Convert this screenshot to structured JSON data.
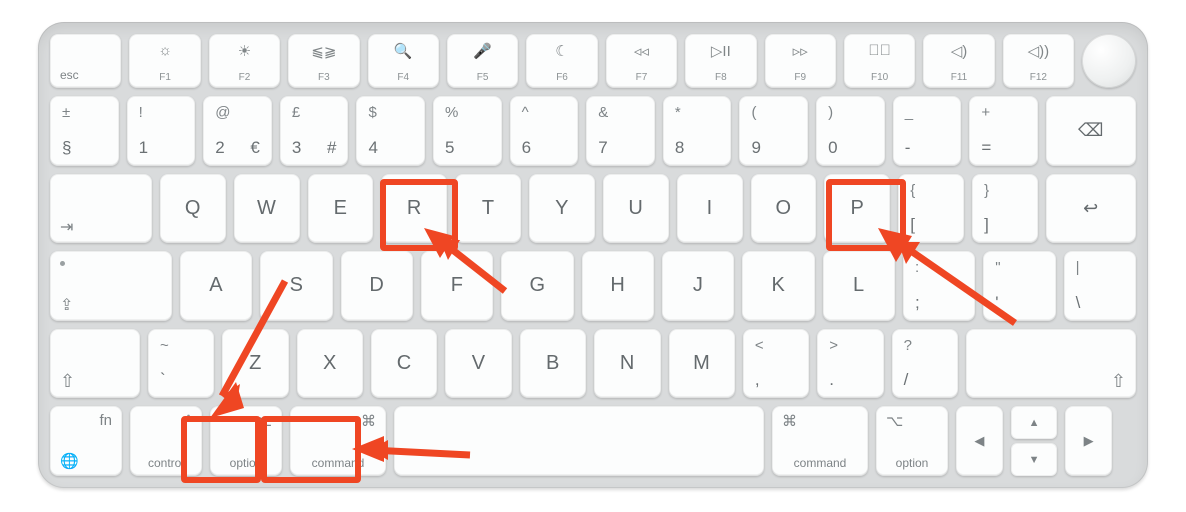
{
  "annotations": {
    "highlight_color": "#ef4623",
    "highlighted_keys": [
      "R",
      "P",
      "option-left",
      "command-left"
    ]
  },
  "fn": {
    "esc": "esc",
    "keys": [
      {
        "icon": "☼",
        "sub": "F1"
      },
      {
        "icon": "☀",
        "sub": "F2"
      },
      {
        "icon": "⫹⫺",
        "sub": "F3"
      },
      {
        "icon": "🔍",
        "sub": "F4"
      },
      {
        "icon": "🎤",
        "sub": "F5"
      },
      {
        "icon": "☾",
        "sub": "F6"
      },
      {
        "icon": "◃◃",
        "sub": "F7"
      },
      {
        "icon": "▷II",
        "sub": "F8"
      },
      {
        "icon": "▹▹",
        "sub": "F9"
      },
      {
        "icon": "◁⃠",
        "sub": "F10"
      },
      {
        "icon": "◁)",
        "sub": "F11"
      },
      {
        "icon": "◁))",
        "sub": "F12"
      }
    ]
  },
  "num": {
    "left": {
      "top": "±",
      "bot": "§"
    },
    "keys": [
      {
        "top": "!",
        "bot": "1"
      },
      {
        "top": "@",
        "bot": "2",
        "botR": "€"
      },
      {
        "top": "£",
        "bot": "3",
        "botR": "#"
      },
      {
        "top": "$",
        "bot": "4"
      },
      {
        "top": "%",
        "bot": "5"
      },
      {
        "top": "^",
        "bot": "6"
      },
      {
        "top": "&",
        "bot": "7"
      },
      {
        "top": "*",
        "bot": "8"
      },
      {
        "top": "(",
        "bot": "9"
      },
      {
        "top": ")",
        "bot": "0"
      },
      {
        "top": "_",
        "bot": "-"
      },
      {
        "top": "+",
        "bot": "="
      }
    ],
    "back": "⌫"
  },
  "qwerty": {
    "tab": "⇥",
    "keys": [
      "Q",
      "W",
      "E",
      "R",
      "T",
      "Y",
      "U",
      "I",
      "O",
      "P"
    ],
    "rb1": {
      "top": "{",
      "bot": "["
    },
    "rb2": {
      "top": "}",
      "bot": "]"
    },
    "ret": "↩"
  },
  "home": {
    "caps_dot": true,
    "keys": [
      "A",
      "S",
      "D",
      "F",
      "G",
      "H",
      "J",
      "K",
      "L"
    ],
    "semi": {
      "top": ":",
      "bot": ";"
    },
    "quote": {
      "top": "\"",
      "bot": "'"
    },
    "bslash": {
      "top": "|",
      "bot": "\\"
    }
  },
  "shift": {
    "shiftL": "⇧",
    "tilde": {
      "top": "~",
      "bot": "`"
    },
    "keys": [
      "Z",
      "X",
      "C",
      "V",
      "B",
      "N",
      "M"
    ],
    "comma": {
      "top": "<",
      "bot": ","
    },
    "dot": {
      "top": ">",
      "bot": "."
    },
    "slash": {
      "top": "?",
      "bot": "/"
    },
    "shiftR": "⇧"
  },
  "bottom": {
    "fn": {
      "top": "fn",
      "icon": "🌐"
    },
    "ctrl": {
      "icon": "^",
      "label": "control"
    },
    "optL": {
      "icon": "⌥",
      "label": "option"
    },
    "cmdL": {
      "icon": "⌘",
      "label": "command"
    },
    "cmdR": {
      "icon": "⌘",
      "label": "command"
    },
    "optR": {
      "icon": "⌥",
      "label": "option"
    },
    "arrows": {
      "left": "◀",
      "up": "▲",
      "down": "▼",
      "right": "▶"
    }
  }
}
